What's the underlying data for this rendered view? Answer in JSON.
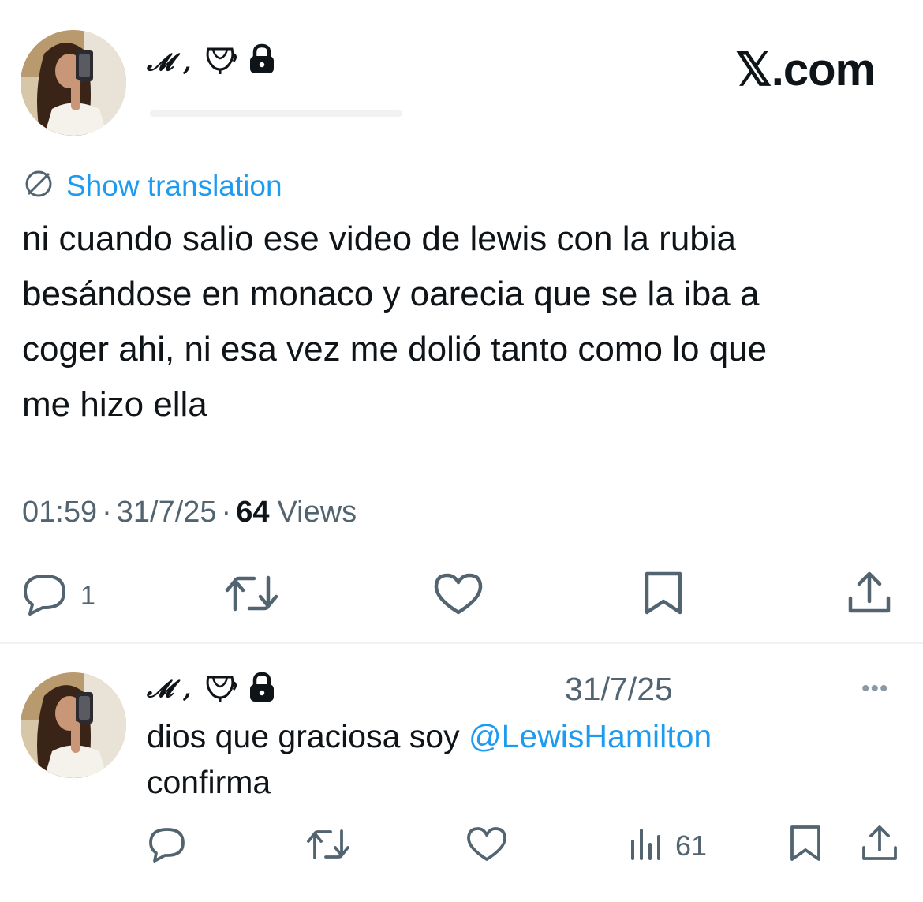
{
  "header": {
    "display_name": "𝓜 ,",
    "brand": "𝕏.com"
  },
  "translation": {
    "label": "Show translation"
  },
  "tweet": {
    "text_lines": [
      "ni cuando salio ese video de lewis con la rubia",
      "besándose en monaco y oarecia que se la iba a",
      "coger ahi, ni esa vez me dolió tanto como lo que",
      "me hizo ella"
    ],
    "time": "01:59",
    "date": "31/7/25",
    "views_count": "64",
    "views_label": "Views",
    "reply_count": "1"
  },
  "reply": {
    "display_name": "𝓜 ,",
    "date": "31/7/25",
    "text_before": "dios que graciosa soy ",
    "mention": "@LewisHamilton",
    "text_after": "confirma",
    "views_count": "61",
    "more": "•••"
  },
  "icons": {
    "emblem": "cup-icon",
    "lock": "lock-icon",
    "translate": "translate-icon",
    "reply": "reply-icon",
    "retweet": "retweet-icon",
    "like": "heart-icon",
    "bookmark": "bookmark-icon",
    "share": "share-icon",
    "views": "views-icon"
  },
  "colors": {
    "accent": "#1d9bf0",
    "text": "#0f1419",
    "muted": "#536471"
  }
}
